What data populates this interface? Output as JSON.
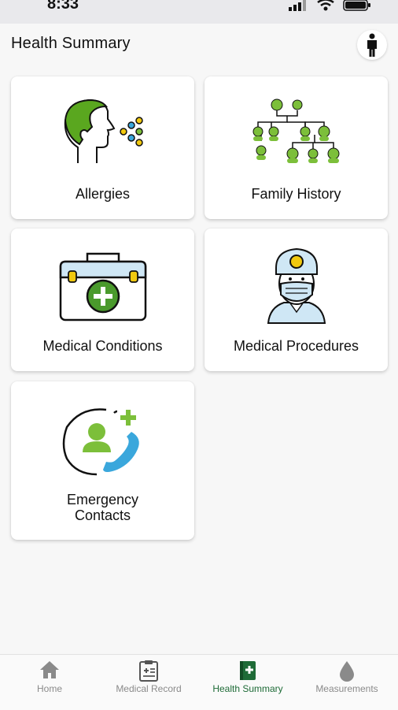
{
  "status_bar": {
    "time": "8:33"
  },
  "header": {
    "title": "Health Summary"
  },
  "cards": [
    {
      "label": "Allergies"
    },
    {
      "label": "Family History"
    },
    {
      "label": "Medical Conditions"
    },
    {
      "label": "Medical Procedures"
    },
    {
      "label_line1": "Emergency",
      "label_line2": "Contacts"
    }
  ],
  "tabbar": {
    "items": [
      {
        "label": "Home",
        "icon": "home-icon"
      },
      {
        "label": "Medical Record",
        "icon": "clipboard-icon"
      },
      {
        "label": "Health Summary",
        "icon": "health-book-icon",
        "active": true
      },
      {
        "label": "Measurements",
        "icon": "drop-icon"
      }
    ]
  },
  "colors": {
    "accent_green": "#1e6b37",
    "illustration_green": "#7cbf3a",
    "illustration_blue": "#3aa7dc",
    "illustration_yellow": "#f1c90f"
  }
}
